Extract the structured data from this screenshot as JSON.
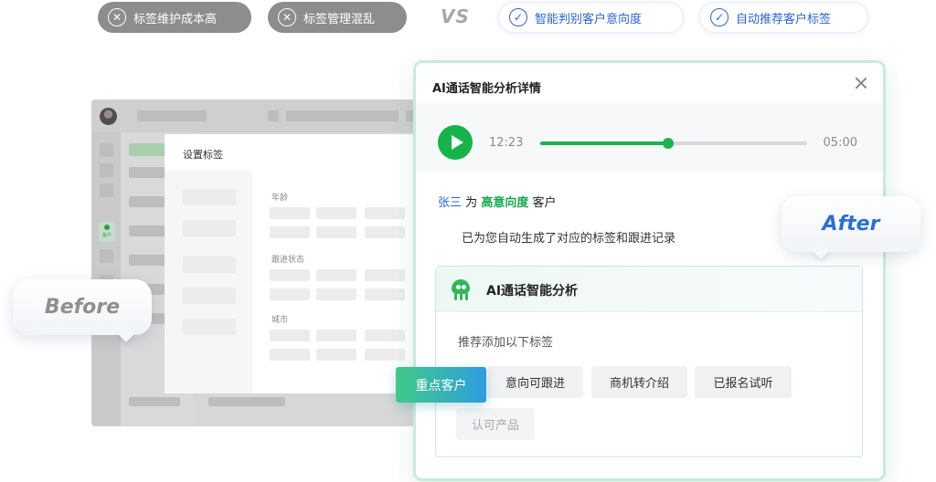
{
  "compare": {
    "before_pills": [
      {
        "label": "标签维护成本高",
        "icon": "close-circle-icon"
      },
      {
        "label": "标签管理混乱",
        "icon": "close-circle-icon"
      }
    ],
    "vs_label": "VS",
    "after_pills": [
      {
        "label": "智能判别客户意向度",
        "icon": "check-circle-icon"
      },
      {
        "label": "自动推荐客户标签",
        "icon": "check-circle-icon"
      }
    ]
  },
  "before": {
    "bubble_label": "Before",
    "sidebar_item_label": "客户",
    "dialog": {
      "title": "设置标签",
      "fields": [
        "年龄",
        "跟进状态",
        "城市"
      ]
    }
  },
  "after": {
    "bubble_label": "After",
    "panel": {
      "title": "AI通话智能分析详情",
      "audio": {
        "current": "12:23",
        "total": "05:00",
        "progress": 0.48
      },
      "customer": {
        "name": "张三",
        "connector": "为",
        "level": "高意向度",
        "suffix": "客户"
      },
      "note": "已为您自动生成了对应的标签和跟进记录",
      "analysis": {
        "title": "AI通话智能分析",
        "subtitle": "推荐添加以下标签",
        "tags": [
          "意向可跟进",
          "商机转介绍",
          "已报名试听",
          "认可产品"
        ]
      }
    },
    "dragged_tag": "重点客户"
  },
  "colors": {
    "accent_green": "#15b34a",
    "accent_blue": "#2b63d9",
    "gray_pill": "#8d8d8d"
  }
}
